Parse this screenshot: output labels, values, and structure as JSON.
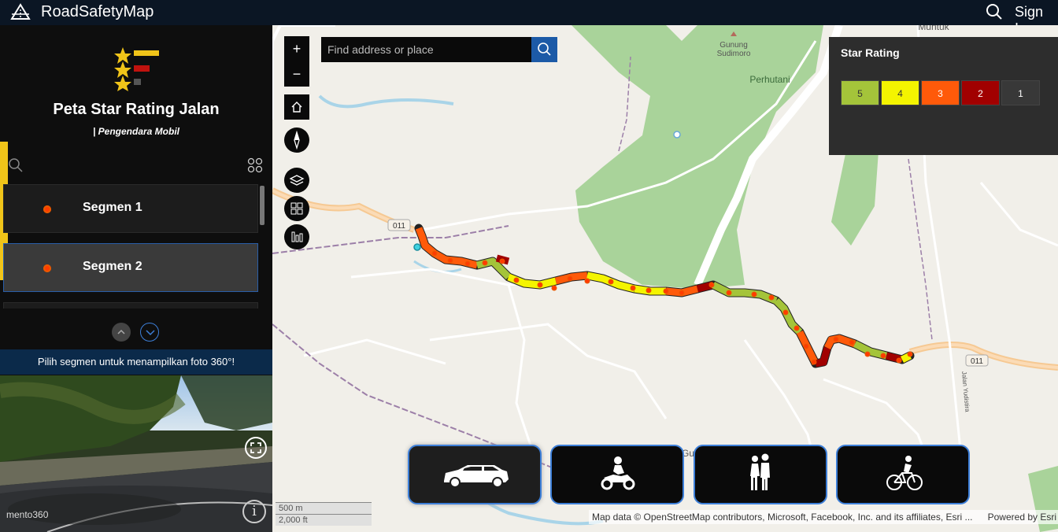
{
  "topbar": {
    "app_title": "RoadSafetyMap",
    "sign_in": "Sign In"
  },
  "panel": {
    "title": "Peta Star Rating Jalan",
    "subtitle": "| Pengendara Mobil",
    "segments": [
      {
        "label": "Segmen 1",
        "active": false
      },
      {
        "label": "Segmen 2",
        "active": true
      }
    ],
    "photo_hint": "Pilih segmen untuk menampilkan foto 360°!",
    "photo_watermark": "mento360"
  },
  "map": {
    "search_placeholder": "Find address or place",
    "zoom_in": "+",
    "zoom_out": "−",
    "labels": {
      "muntuk": "Muntuk",
      "gunung": "Gunung",
      "sudimoro": "Sudimoro",
      "perhutani": "Perhutani",
      "route_011_a": "011",
      "route_011_b": "011",
      "jalan_yudistira": "Jalan Yudistira",
      "gun": "Gun"
    },
    "legend": {
      "title": "Star Rating",
      "items": [
        {
          "label": "5",
          "color": "#a4c43a"
        },
        {
          "label": "4",
          "color": "#f4f400"
        },
        {
          "label": "3",
          "color": "#ff5a0a"
        },
        {
          "label": "2",
          "color": "#a10000"
        },
        {
          "label": "1",
          "color": "#383838"
        }
      ]
    },
    "modes": [
      "car-icon",
      "motorcycle-icon",
      "pedestrian-icon",
      "bicycle-icon"
    ],
    "scale": {
      "metric": "500 m",
      "imperial": "2,000 ft"
    },
    "attribution": "Map data © OpenStreetMap contributors, Microsoft, Facebook, Inc. and its affiliates, Esri ...",
    "powered_by": "Powered by Esri"
  }
}
